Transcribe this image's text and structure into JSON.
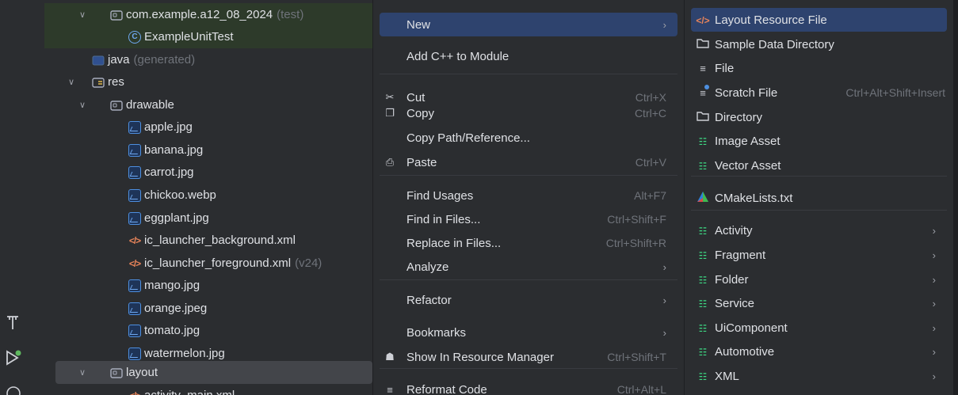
{
  "tree": {
    "rows": [
      {
        "label": "com.example.a12_08_2024",
        "suffix": "(test)",
        "icon": "package-folder-icon",
        "chevron": "expanded"
      },
      {
        "label": "ExampleUnitTest",
        "suffix": "",
        "icon": "class-icon",
        "chevron": ""
      },
      {
        "label": "java",
        "suffix": "(generated)",
        "icon": "generated-folder-icon",
        "chevron": ""
      },
      {
        "label": "res",
        "suffix": "",
        "icon": "res-folder-icon",
        "chevron": "expanded"
      },
      {
        "label": "drawable",
        "suffix": "",
        "icon": "folder-icon",
        "chevron": "expanded"
      },
      {
        "label": "apple.jpg",
        "suffix": "",
        "icon": "image-file-icon",
        "chevron": ""
      },
      {
        "label": "banana.jpg",
        "suffix": "",
        "icon": "image-file-icon",
        "chevron": ""
      },
      {
        "label": "carrot.jpg",
        "suffix": "",
        "icon": "image-file-icon",
        "chevron": ""
      },
      {
        "label": "chickoo.webp",
        "suffix": "",
        "icon": "image-file-icon",
        "chevron": ""
      },
      {
        "label": "eggplant.jpg",
        "suffix": "",
        "icon": "image-file-icon",
        "chevron": ""
      },
      {
        "label": "ic_launcher_background.xml",
        "suffix": "",
        "icon": "xml-file-icon",
        "chevron": ""
      },
      {
        "label": "ic_launcher_foreground.xml",
        "suffix": "(v24)",
        "icon": "xml-file-icon",
        "chevron": ""
      },
      {
        "label": "mango.jpg",
        "suffix": "",
        "icon": "image-file-icon",
        "chevron": ""
      },
      {
        "label": "orange.jpeg",
        "suffix": "",
        "icon": "image-file-icon",
        "chevron": ""
      },
      {
        "label": "tomato.jpg",
        "suffix": "",
        "icon": "image-file-icon",
        "chevron": ""
      },
      {
        "label": "watermelon.jpg",
        "suffix": "",
        "icon": "image-file-icon",
        "chevron": ""
      },
      {
        "label": "layout",
        "suffix": "",
        "icon": "folder-icon",
        "chevron": "expanded"
      },
      {
        "label": "activity_main.xml",
        "suffix": "",
        "icon": "xml-file-icon",
        "chevron": ""
      }
    ]
  },
  "context_menu": {
    "items": [
      {
        "label": "New",
        "shortcut": "",
        "submenu": true,
        "icon": ""
      },
      {
        "label": "Add C++ to Module",
        "shortcut": "",
        "submenu": false,
        "icon": ""
      },
      {
        "label": "Cut",
        "shortcut": "Ctrl+X",
        "submenu": false,
        "icon": "scissors-icon"
      },
      {
        "label": "Copy",
        "shortcut": "Ctrl+C",
        "submenu": false,
        "icon": "copy-icon"
      },
      {
        "label": "Copy Path/Reference...",
        "shortcut": "",
        "submenu": false,
        "icon": ""
      },
      {
        "label": "Paste",
        "shortcut": "Ctrl+V",
        "submenu": false,
        "icon": "paste-icon"
      },
      {
        "label": "Find Usages",
        "shortcut": "Alt+F7",
        "submenu": false,
        "icon": ""
      },
      {
        "label": "Find in Files...",
        "shortcut": "Ctrl+Shift+F",
        "submenu": false,
        "icon": ""
      },
      {
        "label": "Replace in Files...",
        "shortcut": "Ctrl+Shift+R",
        "submenu": false,
        "icon": ""
      },
      {
        "label": "Analyze",
        "shortcut": "",
        "submenu": true,
        "icon": ""
      },
      {
        "label": "Refactor",
        "shortcut": "",
        "submenu": true,
        "icon": ""
      },
      {
        "label": "Bookmarks",
        "shortcut": "",
        "submenu": true,
        "icon": ""
      },
      {
        "label": "Show In Resource Manager",
        "shortcut": "Ctrl+Shift+T",
        "submenu": false,
        "icon": "resource-manager-icon"
      },
      {
        "label": "Reformat Code",
        "shortcut": "Ctrl+Alt+L",
        "submenu": false,
        "icon": "reformat-icon"
      }
    ]
  },
  "new_submenu": {
    "items": [
      {
        "label": "Layout Resource File",
        "shortcut": "",
        "submenu": false,
        "icon": "xml-file-icon"
      },
      {
        "label": "Sample Data Directory",
        "shortcut": "",
        "submenu": false,
        "icon": "folder-icon"
      },
      {
        "label": "File",
        "shortcut": "",
        "submenu": false,
        "icon": "file-icon"
      },
      {
        "label": "Scratch File",
        "shortcut": "Ctrl+Alt+Shift+Insert",
        "submenu": false,
        "icon": "scratch-file-icon"
      },
      {
        "label": "Directory",
        "shortcut": "",
        "submenu": false,
        "icon": "folder-icon"
      },
      {
        "label": "Image Asset",
        "shortcut": "",
        "submenu": false,
        "icon": "android-icon"
      },
      {
        "label": "Vector Asset",
        "shortcut": "",
        "submenu": false,
        "icon": "android-icon"
      },
      {
        "label": "CMakeLists.txt",
        "shortcut": "",
        "submenu": false,
        "icon": "cmake-icon"
      },
      {
        "label": "Activity",
        "shortcut": "",
        "submenu": true,
        "icon": "android-icon"
      },
      {
        "label": "Fragment",
        "shortcut": "",
        "submenu": true,
        "icon": "android-icon"
      },
      {
        "label": "Folder",
        "shortcut": "",
        "submenu": true,
        "icon": "android-icon"
      },
      {
        "label": "Service",
        "shortcut": "",
        "submenu": true,
        "icon": "android-icon"
      },
      {
        "label": "UiComponent",
        "shortcut": "",
        "submenu": true,
        "icon": "android-icon"
      },
      {
        "label": "Automotive",
        "shortcut": "",
        "submenu": true,
        "icon": "android-icon"
      },
      {
        "label": "XML",
        "shortcut": "",
        "submenu": true,
        "icon": "android-icon"
      }
    ]
  },
  "colors": {
    "background": "#2b2d30",
    "selection": "#2e436e",
    "test_highlight": "#2d3a2a",
    "shortcut_text": "#6f737a",
    "android_green": "#3ddc84"
  }
}
